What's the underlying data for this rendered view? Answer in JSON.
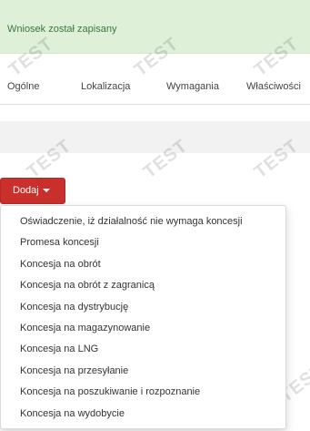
{
  "alert": {
    "message": "Wniosek został zapisany",
    "color": "#dff0d8"
  },
  "watermark": {
    "text": "TEST"
  },
  "tabs": [
    {
      "label": "Ogólne"
    },
    {
      "label": "Lokalizacja"
    },
    {
      "label": "Wymagania"
    },
    {
      "label": "Właściwości"
    }
  ],
  "add_button": {
    "label": "Dodaj",
    "icon": "caret-down-icon",
    "color": "#c9302c"
  },
  "dropdown": {
    "items": [
      {
        "label": "Oświadczenie, iż działalność nie wymaga koncesji"
      },
      {
        "label": "Promesa koncesji"
      },
      {
        "label": "Koncesja na obrót"
      },
      {
        "label": "Koncesja na obrót z zagranicą"
      },
      {
        "label": "Koncesja na dystrybucję"
      },
      {
        "label": "Koncesja na magazynowanie"
      },
      {
        "label": "Koncesja na LNG"
      },
      {
        "label": "Koncesja na przesyłanie"
      },
      {
        "label": "Koncesja na poszukiwanie i rozpoznanie"
      },
      {
        "label": "Koncesja na wydobycie"
      }
    ]
  }
}
